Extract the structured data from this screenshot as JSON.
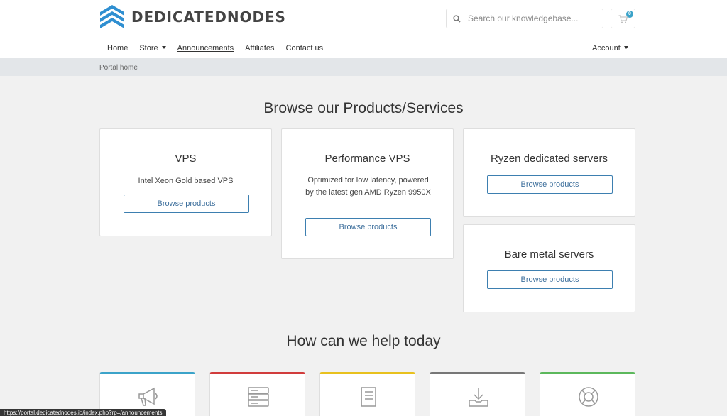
{
  "brand": {
    "name": "DEDICATEDNODES"
  },
  "search": {
    "placeholder": "Search our knowledgebase..."
  },
  "cart": {
    "count": "0"
  },
  "nav": {
    "items": [
      {
        "label": "Home"
      },
      {
        "label": "Store"
      },
      {
        "label": "Announcements"
      },
      {
        "label": "Affiliates"
      },
      {
        "label": "Contact us"
      }
    ],
    "account": "Account"
  },
  "breadcrumb": "Portal home",
  "products": {
    "title": "Browse our Products/Services",
    "cards": [
      {
        "title": "VPS",
        "description": "Intel Xeon Gold based VPS",
        "button": "Browse products"
      },
      {
        "title": "Performance VPS",
        "description": "Optimized for low latency, powered by the latest gen AMD Ryzen 9950X",
        "button": "Browse products"
      },
      {
        "title": "Ryzen dedicated servers",
        "button": "Browse products"
      },
      {
        "title": "Bare metal servers",
        "button": "Browse products"
      }
    ]
  },
  "help": {
    "title": "How can we help today",
    "cards": [
      {
        "icon": "megaphone-icon",
        "accent": "#3ba3c9"
      },
      {
        "icon": "server-icon",
        "accent": "#d13c3c"
      },
      {
        "icon": "book-icon",
        "accent": "#e8c11e"
      },
      {
        "icon": "download-icon",
        "accent": "#777777"
      },
      {
        "icon": "lifebuoy-icon",
        "accent": "#5cb85c"
      }
    ]
  },
  "colors": {
    "brand": "#2f8fd1",
    "button_border": "#3d7fb0",
    "breadcrumb_bg": "#e3e6e9",
    "page_bg": "#f1f1f1"
  },
  "status_url": "https://portal.dedicatednodes.io/index.php?rp=/announcements"
}
